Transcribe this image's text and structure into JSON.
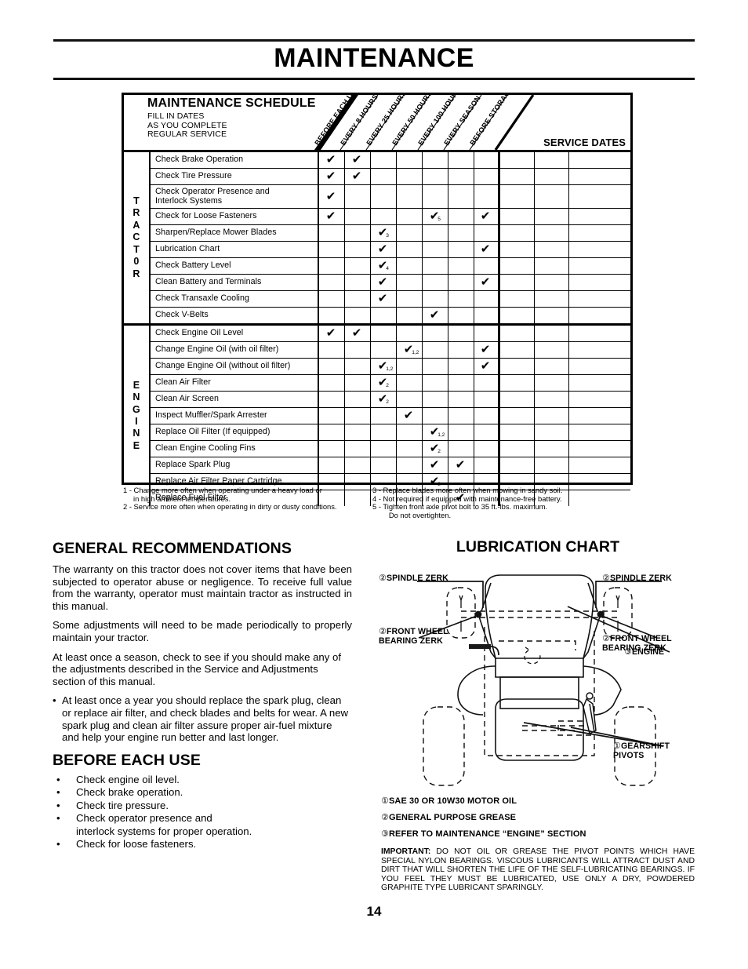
{
  "page": {
    "title": "MAINTENANCE",
    "number": "14"
  },
  "schedule": {
    "title": "MAINTENANCE SCHEDULE",
    "subtitle_lines": [
      "FILL IN DATES",
      "AS YOU COMPLETE",
      "REGULAR SERVICE"
    ],
    "columns": [
      "BEFORE EACH USE",
      "EVERY 8 HOURS",
      "EVERY 25 HOURS",
      "EVERY 50 HOURS",
      "EVERY 100 HOURS",
      "EVERY SEASON",
      "BEFORE STORAGE"
    ],
    "service_dates_label": "SERVICE DATES",
    "service_date_columns": 3,
    "sections": [
      {
        "label": "TRACT0R",
        "rows": [
          {
            "task": "Check Brake Operation",
            "marks": [
              {
                "col": 0
              },
              {
                "col": 1
              }
            ]
          },
          {
            "task": "Check Tire Pressure",
            "marks": [
              {
                "col": 0
              },
              {
                "col": 1
              }
            ]
          },
          {
            "task": "Check Operator Presence and\nInterlock Systems",
            "tall": true,
            "marks": [
              {
                "col": 0
              }
            ]
          },
          {
            "task": "Check for Loose Fasteners",
            "marks": [
              {
                "col": 0
              },
              {
                "col": 4,
                "note": "5"
              },
              {
                "col": 6
              }
            ]
          },
          {
            "task": "Sharpen/Replace Mower Blades",
            "marks": [
              {
                "col": 2,
                "note": "3"
              }
            ]
          },
          {
            "task": "Lubrication Chart",
            "marks": [
              {
                "col": 2
              },
              {
                "col": 6
              }
            ]
          },
          {
            "task": "Check Battery Level",
            "marks": [
              {
                "col": 2,
                "note": "4"
              }
            ]
          },
          {
            "task": "Clean Battery and Terminals",
            "marks": [
              {
                "col": 2
              },
              {
                "col": 6
              }
            ]
          },
          {
            "task": "Check Transaxle Cooling",
            "marks": [
              {
                "col": 2
              }
            ]
          },
          {
            "task": "Check V-Belts",
            "marks": [
              {
                "col": 4
              }
            ]
          }
        ]
      },
      {
        "label": "ENGINE",
        "rows": [
          {
            "task": "Check Engine Oil Level",
            "marks": [
              {
                "col": 0
              },
              {
                "col": 1
              }
            ]
          },
          {
            "task": "Change Engine Oil (with oil filter)",
            "marks": [
              {
                "col": 3,
                "note": "1,2"
              },
              {
                "col": 6
              }
            ]
          },
          {
            "task": "Change Engine Oil (without oil filter)",
            "marks": [
              {
                "col": 2,
                "note": "1,2"
              },
              {
                "col": 6
              }
            ]
          },
          {
            "task": "Clean Air Filter",
            "marks": [
              {
                "col": 2,
                "note": "2"
              }
            ]
          },
          {
            "task": "Clean Air Screen",
            "marks": [
              {
                "col": 2,
                "note": "2"
              }
            ]
          },
          {
            "task": "Inspect Muffler/Spark Arrester",
            "marks": [
              {
                "col": 3
              }
            ]
          },
          {
            "task": "Replace Oil Filter (If equipped)",
            "marks": [
              {
                "col": 4,
                "note": "1,2"
              }
            ]
          },
          {
            "task": "Clean Engine Cooling Fins",
            "marks": [
              {
                "col": 4,
                "note": "2"
              }
            ]
          },
          {
            "task": "Replace Spark Plug",
            "marks": [
              {
                "col": 4
              },
              {
                "col": 5
              }
            ]
          },
          {
            "task": "Replace Air Filter Paper Cartridge",
            "marks": [
              {
                "col": 4,
                "note": "2"
              }
            ]
          },
          {
            "task": "Replace Fuel Filter",
            "marks": [
              {
                "col": 5
              }
            ]
          }
        ]
      }
    ],
    "footnotes_left": [
      "1 - Change more often when operating under a heavy load or",
      "     in high ambient temperatures.",
      "2 - Service more often when operating in dirty or dusty conditions."
    ],
    "footnotes_right": [
      "3 - Replace blades more often when mowing in sandy soil.",
      "4 - Not required if equipped with maintenance-free battery.",
      "5 - Tighten front axle pivot bolt to 35 ft.-lbs. maximum.",
      "        Do not overtighten."
    ]
  },
  "general_recommendations": {
    "heading": "GENERAL RECOMMENDATIONS",
    "paragraphs": [
      "The warranty on this tractor does not cover items that have been subjected to operator abuse or negligence. To receive full value from the warranty, operator must maintain tractor as instructed in this manual.",
      "Some adjustments will need to be made periodically to properly maintain your tractor.",
      "At least once a season, check to see if you should make any of the adjustments described in the Service and Adjustments section of this manual."
    ],
    "bullet": "At least once a year you should replace the spark plug, clean or replace air filter, and check blades and belts for wear.  A new spark plug and clean air filter assure proper air-fuel mixture and help your engine run better and last longer."
  },
  "before_each_use": {
    "heading": "BEFORE EACH USE",
    "items": [
      "Check engine oil level.",
      "Check brake operation.",
      "Check tire pressure.",
      "Check operator presence and\ninterlock systems for proper operation.",
      "Check for loose fasteners."
    ]
  },
  "lubrication": {
    "heading": "LUBRICATION CHART",
    "callouts": [
      {
        "marker": "②",
        "lines": [
          "SPINDLE ZERK"
        ]
      },
      {
        "marker": "②",
        "lines": [
          "SPINDLE ZERK"
        ]
      },
      {
        "marker": "②",
        "lines": [
          "FRONT WHEEL",
          "BEARING  ZERK"
        ]
      },
      {
        "marker": "②",
        "lines": [
          "FRONT WHEEL",
          "BEARING  ZERK"
        ]
      },
      {
        "marker": "③",
        "lines": [
          "ENGINE"
        ]
      },
      {
        "marker": "①",
        "lines": [
          "GEARSHIFT",
          "PIVOTS"
        ]
      }
    ],
    "legend": [
      {
        "marker": "①",
        "text": "SAE 30 OR 10W30 MOTOR OIL"
      },
      {
        "marker": "②",
        "text": "GENERAL PURPOSE GREASE"
      },
      {
        "marker": "③",
        "text": "REFER TO MAINTENANCE “ENGINE”  SECTION"
      }
    ],
    "important_label": "IMPORTANT:",
    "important_text": "DO NOT OIL OR GREASE THE PIVOT POINTS WHICH HAVE SPECIAL NYLON BEARINGS.  VISCOUS LUBRICANTS WILL ATTRACT DUST AND DIRT THAT WILL SHORTEN THE LIFE OF THE SELF-LUBRICATING BEARINGS.  IF YOU FEEL THEY MUST BE LUBRICATED, USE ONLY A DRY, POWDERED GRAPHITE TYPE LUBRICANT SPARINGLY."
  }
}
